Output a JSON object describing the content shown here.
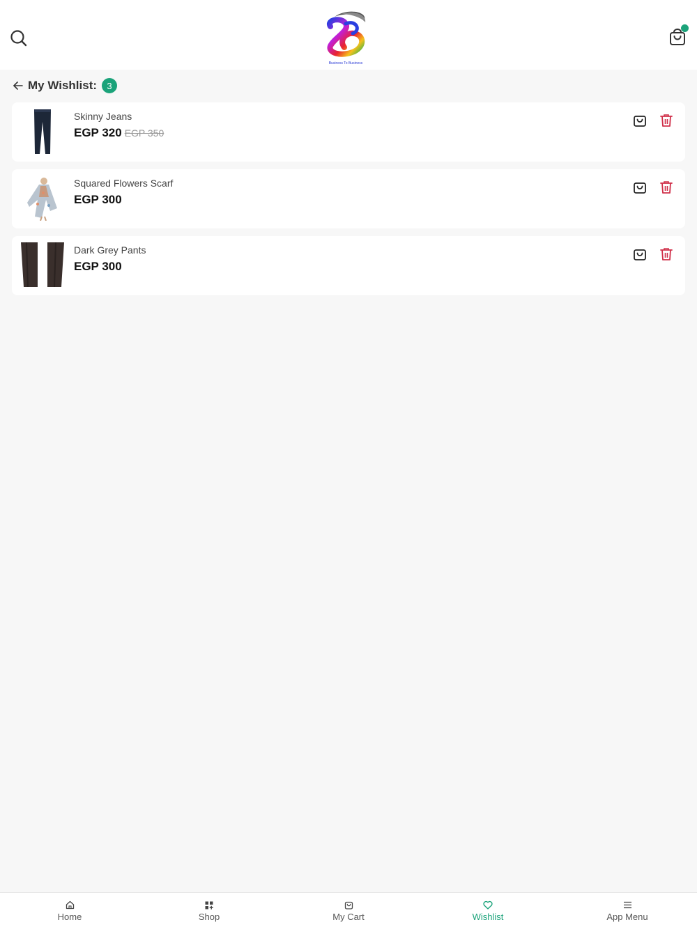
{
  "colors": {
    "accent": "#1ba37a",
    "delete": "#d0304a",
    "badge": "#1ba37a"
  },
  "header": {
    "logo_tagline": "Business To Business"
  },
  "title": {
    "text": "My Wishlist:",
    "count": "3"
  },
  "items": [
    {
      "name": "Skinny Jeans",
      "price": "EGP 320",
      "old_price": "EGP 350",
      "thumb": "jeans"
    },
    {
      "name": "Squared Flowers Scarf",
      "price": "EGP 300",
      "old_price": "",
      "thumb": "scarf"
    },
    {
      "name": "Dark Grey Pants",
      "price": "EGP 300",
      "old_price": "",
      "thumb": "pants"
    }
  ],
  "nav": [
    {
      "label": "Home",
      "icon": "home-icon"
    },
    {
      "label": "Shop",
      "icon": "grid-icon"
    },
    {
      "label": "My Cart",
      "icon": "bag-icon"
    },
    {
      "label": "Wishlist",
      "icon": "heart-icon",
      "active": true
    },
    {
      "label": "App Menu",
      "icon": "menu-icon"
    }
  ]
}
